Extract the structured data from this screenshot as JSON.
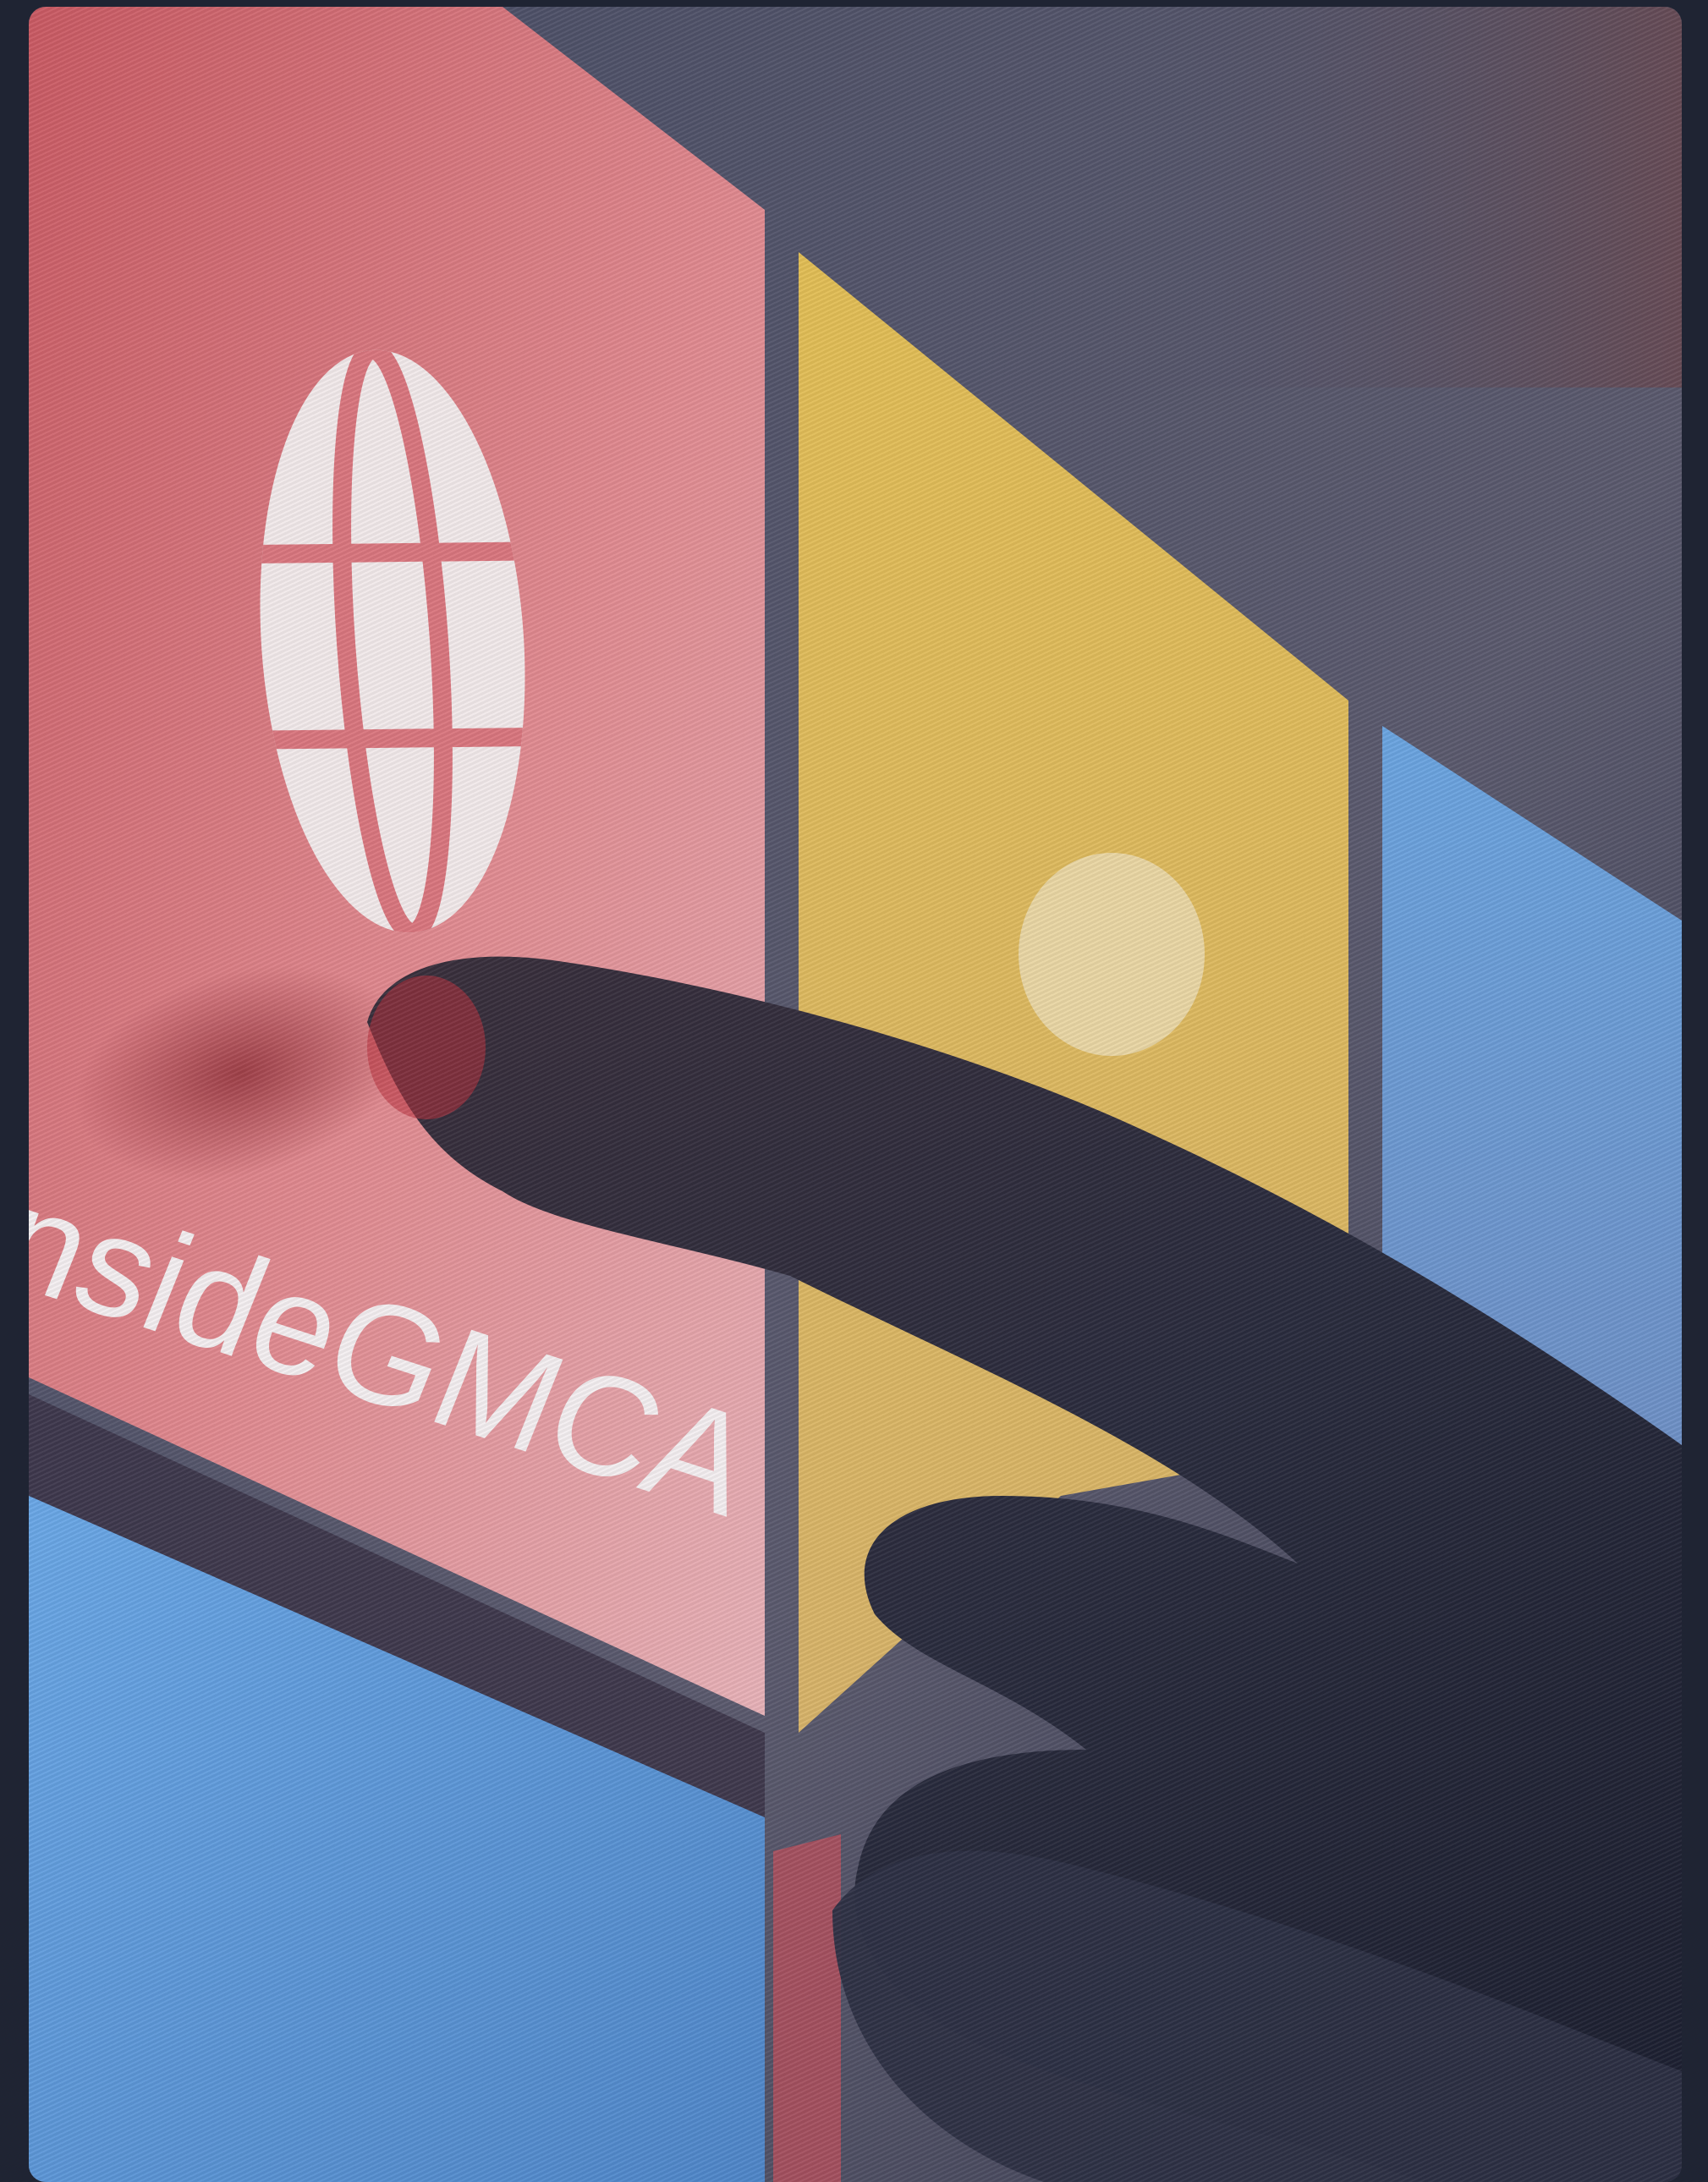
{
  "photo": {
    "tile_label": "InsideGMCA",
    "icon": "globe-icon",
    "colors": {
      "frame": "#1f2433",
      "red_tile": "#d9666c",
      "yellow_tile": "#e8c45a",
      "blue_tile": "#5a9ad8",
      "top_band": "#4b4f66",
      "hand": "#2b2d3d"
    }
  }
}
